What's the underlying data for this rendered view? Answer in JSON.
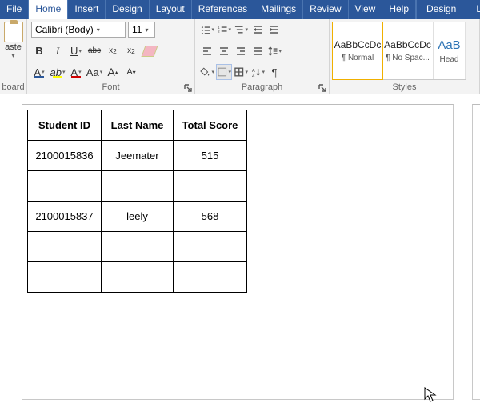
{
  "menu": {
    "tabs": [
      "File",
      "Home",
      "Insert",
      "Design",
      "Layout",
      "References",
      "Mailings",
      "Review",
      "View",
      "Help"
    ],
    "active_index": 1,
    "tool_tabs": [
      "Design",
      "Layout"
    ]
  },
  "clipboard": {
    "paste": "aste",
    "label": "board"
  },
  "font": {
    "name": "Calibri (Body)",
    "size": "11",
    "label": "Font"
  },
  "paragraph": {
    "label": "Paragraph"
  },
  "styles": {
    "label": "Styles",
    "items": [
      {
        "preview": "AaBbCcDc",
        "name": "¶ Normal"
      },
      {
        "preview": "AaBbCcDc",
        "name": "¶ No Spac..."
      },
      {
        "preview": "AaB",
        "name": "Head"
      }
    ]
  },
  "table": {
    "headers": [
      "Student ID",
      "Last Name",
      "Total Score"
    ],
    "rows": [
      [
        "2100015836",
        "Jeemater",
        "515"
      ],
      [
        "",
        "",
        ""
      ],
      [
        "2100015837",
        "leely",
        "568"
      ],
      [
        "",
        "",
        ""
      ],
      [
        "",
        "",
        ""
      ]
    ]
  }
}
